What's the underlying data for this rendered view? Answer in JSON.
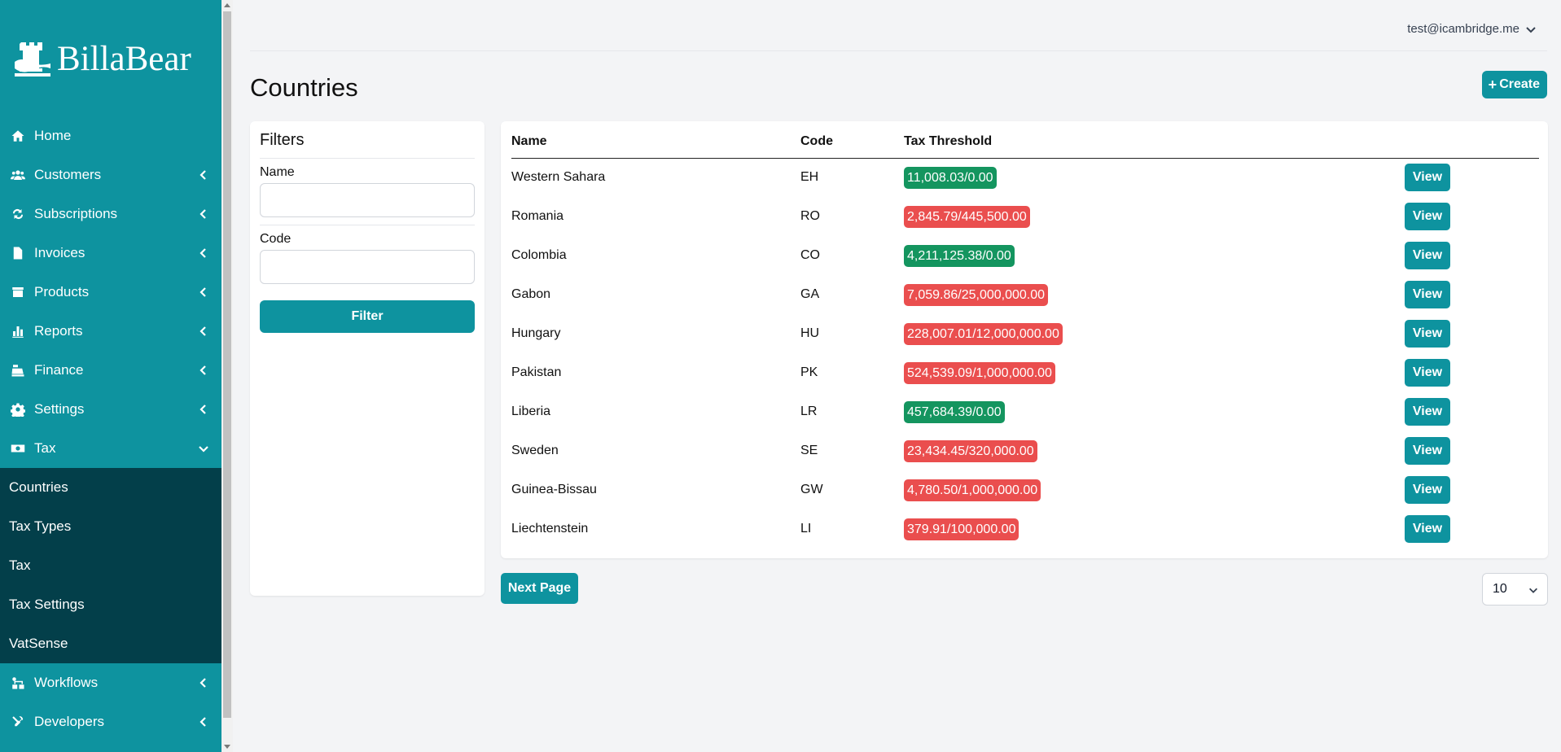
{
  "app": {
    "name": "BillaBear"
  },
  "sidebar": {
    "items": [
      {
        "label": "Home",
        "icon": "home-icon"
      },
      {
        "label": "Customers",
        "icon": "users-icon"
      },
      {
        "label": "Subscriptions",
        "icon": "repeat-icon"
      },
      {
        "label": "Invoices",
        "icon": "invoice-icon"
      },
      {
        "label": "Products",
        "icon": "box-icon"
      },
      {
        "label": "Reports",
        "icon": "chart-icon"
      },
      {
        "label": "Finance",
        "icon": "cash-register-icon"
      },
      {
        "label": "Settings",
        "icon": "gear-icon"
      },
      {
        "label": "Tax",
        "icon": "money-bill-icon"
      },
      {
        "label": "Workflows",
        "icon": "workflow-icon"
      },
      {
        "label": "Developers",
        "icon": "tools-icon"
      }
    ],
    "tax_submenu": [
      "Countries",
      "Tax Types",
      "Tax",
      "Tax Settings",
      "VatSense"
    ]
  },
  "header": {
    "user_email": "test@icambridge.me"
  },
  "page": {
    "title": "Countries",
    "create_label": "Create"
  },
  "filters": {
    "title": "Filters",
    "name_label": "Name",
    "code_label": "Code",
    "name_value": "",
    "code_value": "",
    "button_label": "Filter"
  },
  "table": {
    "columns": [
      "Name",
      "Code",
      "Tax Threshold"
    ],
    "rows": [
      {
        "name": "Western Sahara",
        "code": "EH",
        "threshold": "11,008.03/0.00",
        "status": "green"
      },
      {
        "name": "Romania",
        "code": "RO",
        "threshold": "2,845.79/445,500.00",
        "status": "red"
      },
      {
        "name": "Colombia",
        "code": "CO",
        "threshold": "4,211,125.38/0.00",
        "status": "green"
      },
      {
        "name": "Gabon",
        "code": "GA",
        "threshold": "7,059.86/25,000,000.00",
        "status": "red"
      },
      {
        "name": "Hungary",
        "code": "HU",
        "threshold": "228,007.01/12,000,000.00",
        "status": "red"
      },
      {
        "name": "Pakistan",
        "code": "PK",
        "threshold": "524,539.09/1,000,000.00",
        "status": "red"
      },
      {
        "name": "Liberia",
        "code": "LR",
        "threshold": "457,684.39/0.00",
        "status": "green"
      },
      {
        "name": "Sweden",
        "code": "SE",
        "threshold": "23,434.45/320,000.00",
        "status": "red"
      },
      {
        "name": "Guinea-Bissau",
        "code": "GW",
        "threshold": "4,780.50/1,000,000.00",
        "status": "red"
      },
      {
        "name": "Liechtenstein",
        "code": "LI",
        "threshold": "379.91/100,000.00",
        "status": "red"
      }
    ],
    "view_label": "View"
  },
  "pagination": {
    "next_label": "Next Page",
    "per_page": "10"
  },
  "colors": {
    "primary": "#0e939f",
    "submenu_bg": "#033f4a",
    "green": "#14955f",
    "red": "#ea4e4e"
  }
}
